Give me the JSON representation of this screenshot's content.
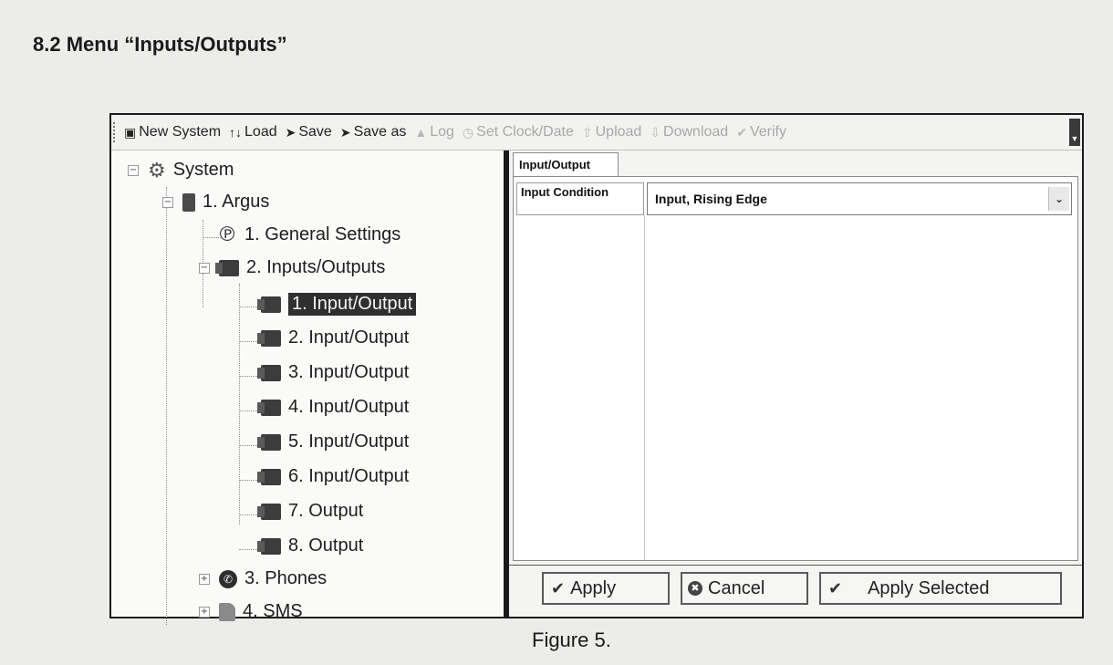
{
  "section_title": "8.2 Menu “Inputs/Outputs”",
  "toolbar": {
    "items": [
      {
        "label": "New System",
        "icon": "new-system-icon",
        "enabled": true
      },
      {
        "label": "Load",
        "icon": "load-icon",
        "enabled": true
      },
      {
        "label": "Save",
        "icon": "save-icon",
        "enabled": true
      },
      {
        "label": "Save as",
        "icon": "save-as-icon",
        "enabled": true
      },
      {
        "label": "Log",
        "icon": "log-icon",
        "enabled": false
      },
      {
        "label": "Set Clock/Date",
        "icon": "clock-icon",
        "enabled": false
      },
      {
        "label": "Upload",
        "icon": "upload-icon",
        "enabled": false
      },
      {
        "label": "Download",
        "icon": "download-icon",
        "enabled": false
      },
      {
        "label": "Verify",
        "icon": "verify-icon",
        "enabled": false
      }
    ]
  },
  "tree": {
    "system": "System",
    "argus": "1. Argus",
    "general_settings": "1. General Settings",
    "inputs_outputs": "2. Inputs/Outputs",
    "io_items": [
      "1. Input/Output",
      "2. Input/Output",
      "3. Input/Output",
      "4. Input/Output",
      "5. Input/Output",
      "6. Input/Output",
      "7. Output",
      "8. Output"
    ],
    "selected_item": "1. Input/Output",
    "phones": "3. Phones",
    "sms": "4. SMS"
  },
  "editor": {
    "tab_label": "Input/Output",
    "property_label": "Input Condition",
    "property_value": "Input, Rising Edge"
  },
  "buttons": {
    "apply": "Apply",
    "cancel": "Cancel",
    "apply_selected": "Apply Selected"
  },
  "figure_caption": "Figure 5.",
  "colors": {
    "page_background": "#ececea",
    "window_frame": "#1a1a1a",
    "selection": "#2f2f2f"
  }
}
